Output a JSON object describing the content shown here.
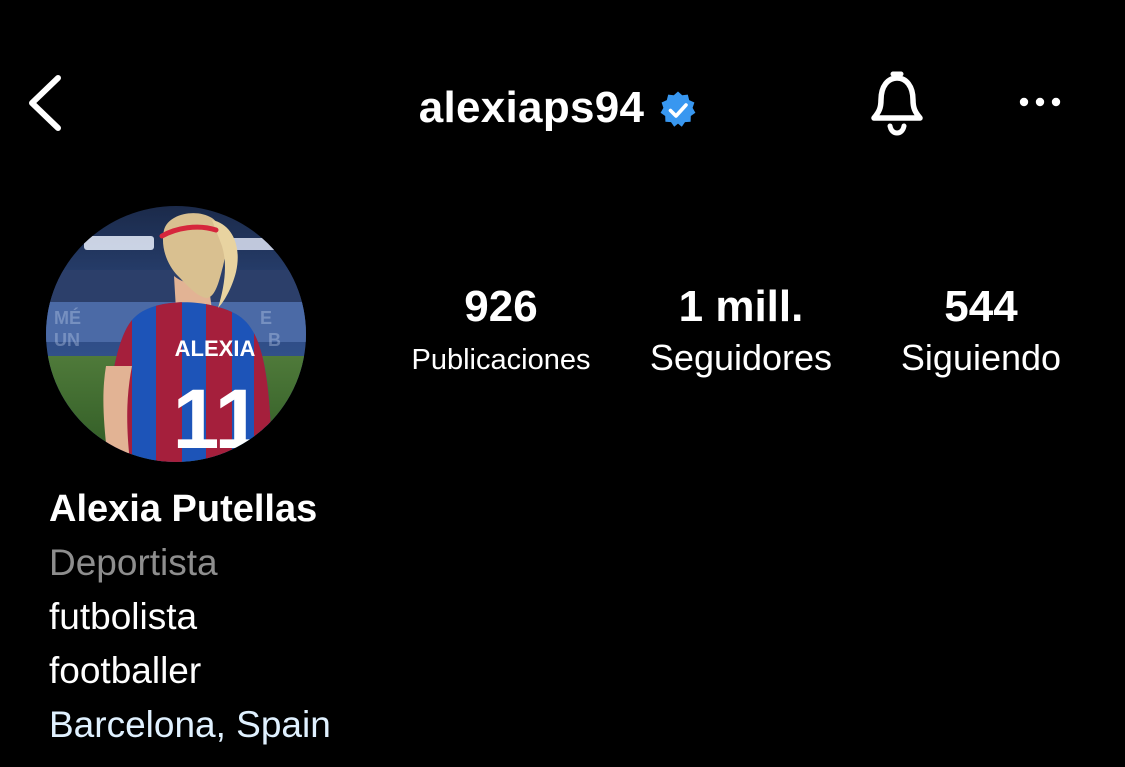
{
  "header": {
    "username": "alexiaps94",
    "verified_color": "#3897f0"
  },
  "profile": {
    "stats": [
      {
        "value": "926",
        "label": "Publicaciones"
      },
      {
        "value": "1 mill.",
        "label": "Seguidores"
      },
      {
        "value": "544",
        "label": "Siguiendo"
      }
    ],
    "avatar_jersey_text": "ALEXIA",
    "avatar_jersey_number": "11"
  },
  "bio": {
    "name": "Alexia Putellas",
    "category": "Deportista",
    "lines": [
      "futbolista",
      "footballer"
    ],
    "location": "Barcelona, Spain"
  },
  "icons": {
    "back": "chevron-left-icon",
    "verified": "verified-badge-icon",
    "notifications": "bell-icon",
    "more": "more-horizontal-icon"
  },
  "colors": {
    "background": "#000000",
    "text": "#ffffff",
    "secondary_text": "#8e8e8e",
    "location_text": "#e0f1ff",
    "verified": "#3897f0"
  }
}
